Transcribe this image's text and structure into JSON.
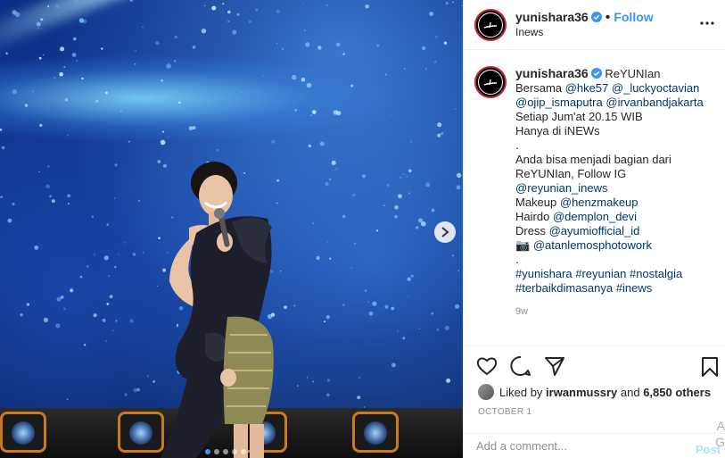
{
  "header": {
    "username": "yunishara36",
    "separator": "•",
    "follow_label": "Follow",
    "location": "Inews"
  },
  "caption": {
    "username": "yunishara36",
    "lines": [
      [
        {
          "t": "ReYUNIan",
          "tag": false
        }
      ],
      [
        {
          "t": "Bersama ",
          "tag": false
        },
        {
          "t": "@hke57",
          "tag": true
        },
        {
          "t": " ",
          "tag": false
        },
        {
          "t": "@_luckyoctavian",
          "tag": true
        }
      ],
      [
        {
          "t": "@ojip_ismaputra",
          "tag": true
        },
        {
          "t": " ",
          "tag": false
        },
        {
          "t": "@irvanbandjakarta",
          "tag": true
        }
      ],
      [
        {
          "t": "Setiap Jum'at 20.15 WIB",
          "tag": false
        }
      ],
      [
        {
          "t": "Hanya di iNEWs",
          "tag": false
        }
      ],
      [
        {
          "t": ".",
          "tag": false
        }
      ],
      [
        {
          "t": "Anda bisa menjadi bagian dari",
          "tag": false
        }
      ],
      [
        {
          "t": "ReYUNIan, Follow IG",
          "tag": false
        }
      ],
      [
        {
          "t": "@reyunian_inews",
          "tag": true
        }
      ],
      [
        {
          "t": "Makeup ",
          "tag": false
        },
        {
          "t": "@henzmakeup",
          "tag": true
        }
      ],
      [
        {
          "t": "Hairdo ",
          "tag": false
        },
        {
          "t": "@demplon_devi",
          "tag": true
        }
      ],
      [
        {
          "t": "Dress ",
          "tag": false
        },
        {
          "t": "@ayumiofficial_id",
          "tag": true
        }
      ],
      [
        {
          "t": "📷 ",
          "tag": false
        },
        {
          "t": "@atanlemosphotowork",
          "tag": true
        }
      ],
      [
        {
          "t": ".",
          "tag": false
        }
      ],
      [
        {
          "t": "#yunishara",
          "tag": true
        },
        {
          "t": " ",
          "tag": false
        },
        {
          "t": "#reyunian",
          "tag": true
        },
        {
          "t": " ",
          "tag": false
        },
        {
          "t": "#nostalgia",
          "tag": true
        }
      ],
      [
        {
          "t": "#terbaikdimasanya",
          "tag": true
        },
        {
          "t": " ",
          "tag": false
        },
        {
          "t": "#inews",
          "tag": true
        }
      ]
    ],
    "time_ago": "9w"
  },
  "likes": {
    "prefix": "Liked by",
    "user": "irwanmussry",
    "and": "and",
    "others": "6,850 others"
  },
  "date": "OCTOBER 1",
  "comment": {
    "placeholder": "Add a comment...",
    "post_label": "Post"
  },
  "os_watermark": "A G",
  "media": {
    "carousel_slides": 5,
    "active_slide": 1
  },
  "colors": {
    "link_blue": "#3897f0",
    "tag_blue": "#00376b",
    "avatar_ring": "#c1272d"
  }
}
